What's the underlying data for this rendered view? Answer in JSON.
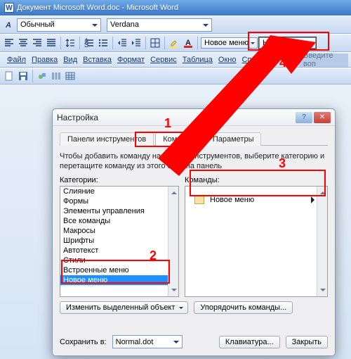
{
  "titlebar": {
    "text": "Документ Microsoft Word.doc - Microsoft Word",
    "doc_icon_letter": "W"
  },
  "format_bar": {
    "style_combo": "Обычный",
    "font_combo": "Verdana",
    "new_menu_1": "Новое меню",
    "new_menu_2": "Новое меню",
    "font_color_letter": "A"
  },
  "menus": {
    "file": "Файл",
    "edit": "Правка",
    "view": "Вид",
    "insert": "Вставка",
    "format": "Формат",
    "tools": "Сервис",
    "table": "Таблица",
    "window": "Окно",
    "help": "Справка",
    "ask": "Введите воп"
  },
  "dialog": {
    "title": "Настройка",
    "tabs": {
      "toolbars": "Панели инструментов",
      "commands": "Команды",
      "options": "Параметры"
    },
    "desc_line1": "Чтобы добавить команду на панель инструментов, выберите категорию и",
    "desc_line2": "перетащите команду из этого окна на панель",
    "cat_label": "Категории:",
    "cmd_label": "Команды:",
    "categories": [
      "Слияние",
      "Формы",
      "Элементы управления",
      "Все команды",
      "Макросы",
      "Шрифты",
      "Автотекст",
      "Стили",
      "Встроенные меню",
      "Новое меню"
    ],
    "drag_item": "Новое меню",
    "change_btn": "Изменить выделенный объект",
    "reorder_btn": "Упорядочить команды...",
    "save_label": "Сохранить в:",
    "save_value": "Normal.dot",
    "keyboard_btn": "Клавиатура...",
    "close_btn": "Закрыть"
  },
  "annotations": {
    "n1": "1",
    "n2": "2",
    "n3": "3",
    "n4": "4"
  }
}
